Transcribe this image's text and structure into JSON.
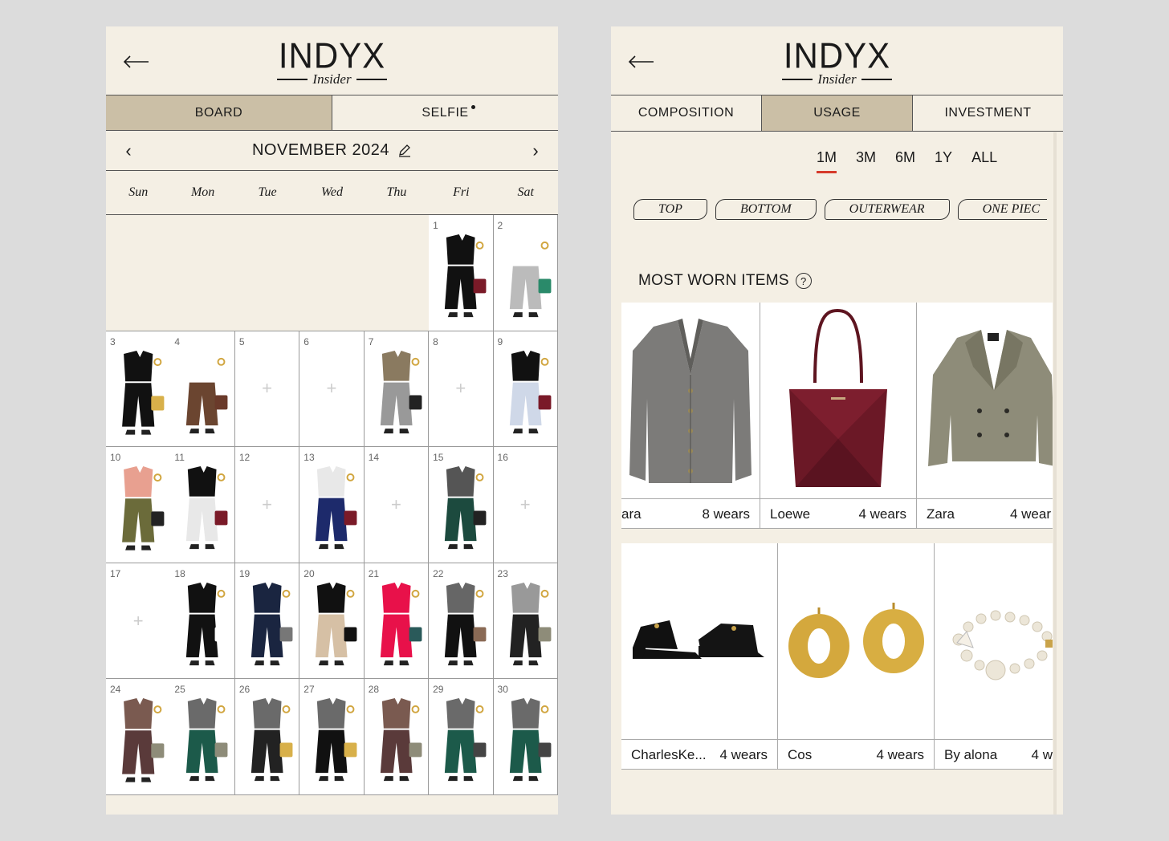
{
  "left": {
    "logo": {
      "main": "INDYX",
      "sub": "Insider"
    },
    "tabs": [
      {
        "label": "BOARD"
      },
      {
        "label": "SELFIE"
      }
    ],
    "month": "NOVEMBER 2024",
    "days": [
      "Sun",
      "Mon",
      "Tue",
      "Wed",
      "Thu",
      "Fri",
      "Sat"
    ],
    "dates": [
      "1",
      "2",
      "3",
      "4",
      "5",
      "6",
      "7",
      "8",
      "9",
      "10",
      "11",
      "12",
      "13",
      "14",
      "15",
      "16",
      "17",
      "18",
      "19",
      "20",
      "21",
      "22",
      "23",
      "24",
      "25",
      "26",
      "27",
      "28",
      "29",
      "30"
    ],
    "plus": "+"
  },
  "right": {
    "logo": {
      "main": "INDYX",
      "sub": "Insider"
    },
    "tabs": [
      {
        "label": "COMPOSITION"
      },
      {
        "label": "USAGE"
      },
      {
        "label": "INVESTMENT"
      }
    ],
    "ranges": [
      "1M",
      "3M",
      "6M",
      "1Y",
      "ALL"
    ],
    "chips": [
      "TOP",
      "BOTTOM",
      "OUTERWEAR",
      "ONE PIEC"
    ],
    "section_title": "MOST WORN ITEMS",
    "help": "?",
    "row1": [
      {
        "brand": "ara",
        "wears": "8 wears"
      },
      {
        "brand": "Loewe",
        "wears": "4 wears"
      },
      {
        "brand": "Zara",
        "wears": "4 wear"
      }
    ],
    "row2": [
      {
        "brand": "CharlesKe...",
        "wears": "4 wears"
      },
      {
        "brand": "Cos",
        "wears": "4 wears"
      },
      {
        "brand": "By alona",
        "wears": "4 w"
      }
    ]
  },
  "colors": {
    "background": "#f4efe4",
    "active_tab": "#cbbfa6",
    "accent": "#d63a2b",
    "page": "#dcdcdc"
  }
}
